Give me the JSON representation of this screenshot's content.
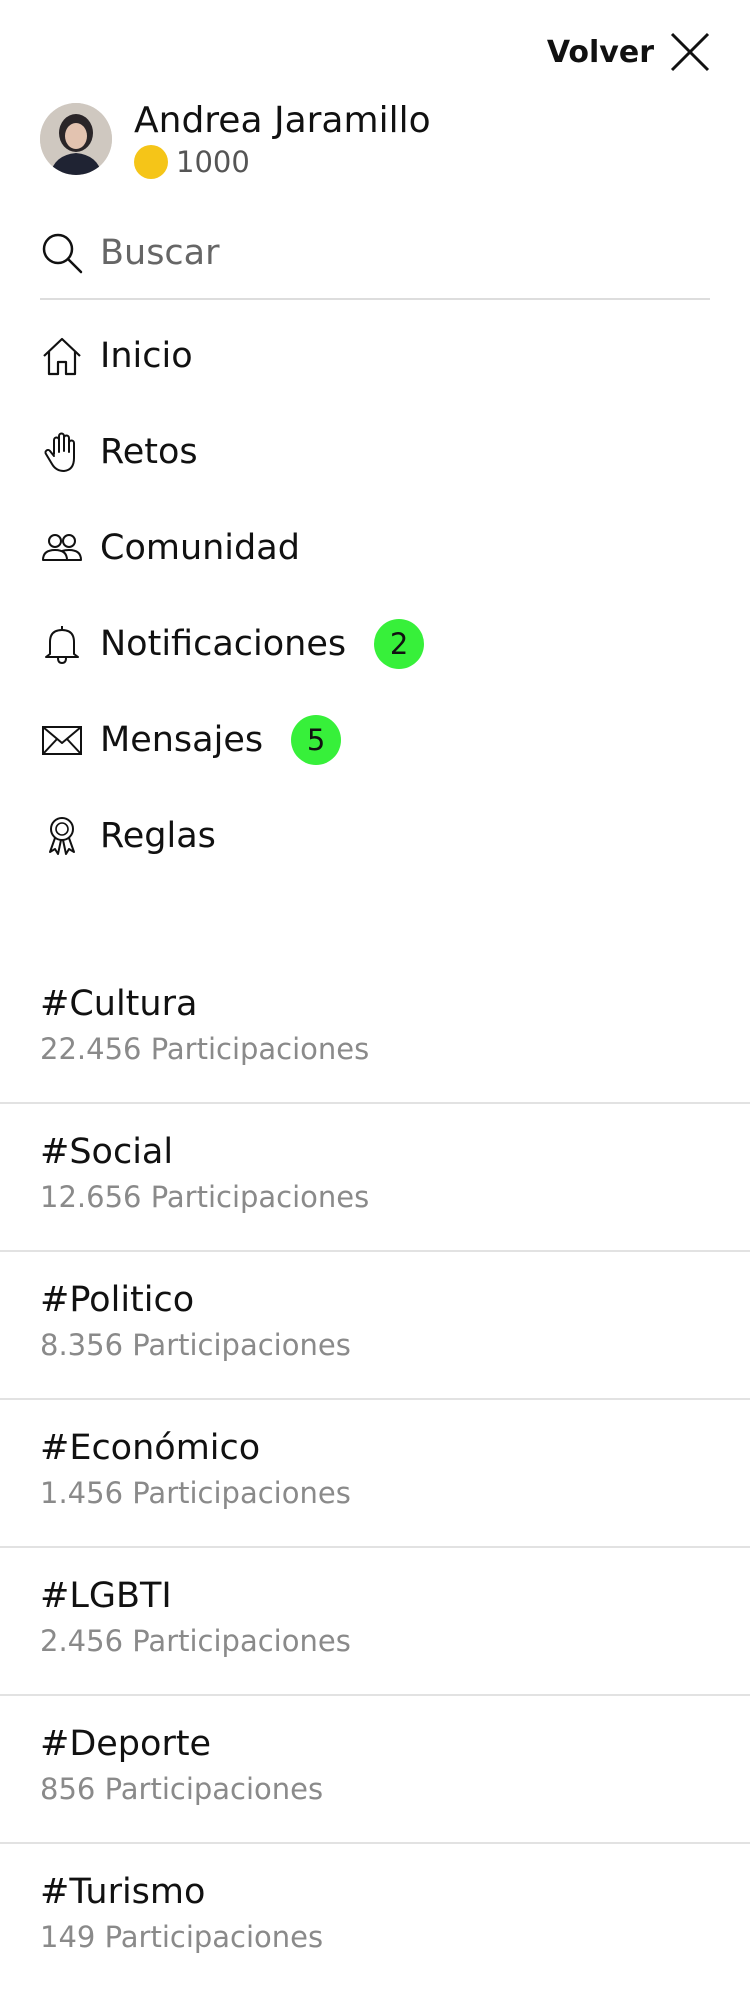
{
  "header": {
    "close_label": "Volver"
  },
  "profile": {
    "name": "Andrea Jaramillo",
    "coins": "1000",
    "coin_color": "#f5c518"
  },
  "search": {
    "placeholder": "Buscar"
  },
  "nav": {
    "items": [
      {
        "label": "Inicio",
        "icon": "home-icon"
      },
      {
        "label": "Retos",
        "icon": "hand-icon"
      },
      {
        "label": "Comunidad",
        "icon": "people-icon"
      },
      {
        "label": "Notificaciones",
        "icon": "bell-icon",
        "badge": "2"
      },
      {
        "label": "Mensajes",
        "icon": "mail-icon",
        "badge": "5"
      },
      {
        "label": "Reglas",
        "icon": "award-ribbon-icon"
      }
    ],
    "badge_color": "#37f03a"
  },
  "topics": [
    {
      "name": "#Cultura",
      "count": "22.456 Participaciones"
    },
    {
      "name": "#Social",
      "count": "12.656 Participaciones"
    },
    {
      "name": "#Politico",
      "count": "8.356 Participaciones"
    },
    {
      "name": "#Económico",
      "count": "1.456 Participaciones"
    },
    {
      "name": "#LGBTI",
      "count": "2.456 Participaciones"
    },
    {
      "name": "#Deporte",
      "count": "856 Participaciones"
    },
    {
      "name": "#Turismo",
      "count": "149 Participaciones"
    }
  ]
}
